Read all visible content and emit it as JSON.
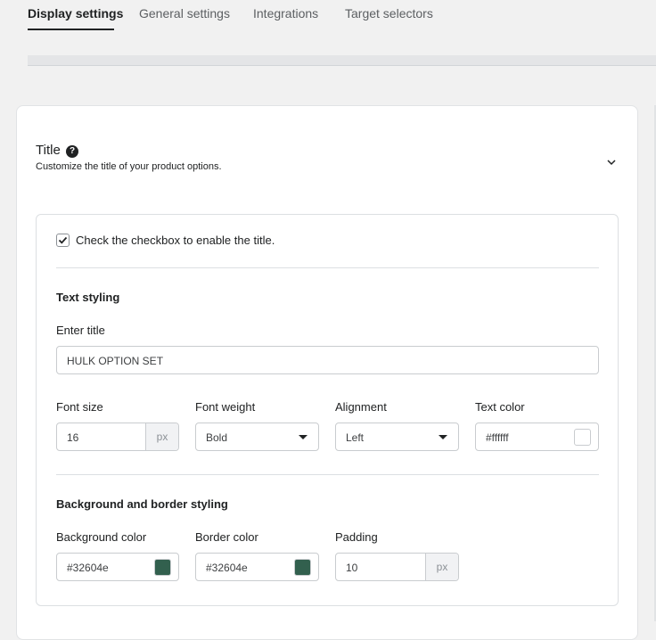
{
  "tabs": [
    {
      "label": "Display settings"
    },
    {
      "label": "General settings"
    },
    {
      "label": "Integrations"
    },
    {
      "label": "Target selectors"
    }
  ],
  "section": {
    "title": "Title",
    "description": "Customize the title of your product options.",
    "help_icon": "?"
  },
  "enable_checkbox": {
    "label": "Check the checkbox to enable the title.",
    "checked": true
  },
  "text_styling": {
    "heading": "Text styling",
    "enter_title_label": "Enter title",
    "title_value": "HULK OPTION SET",
    "font_size": {
      "label": "Font size",
      "value": "16",
      "unit": "px"
    },
    "font_weight": {
      "label": "Font weight",
      "value": "Bold"
    },
    "alignment": {
      "label": "Alignment",
      "value": "Left"
    },
    "text_color": {
      "label": "Text color",
      "value": "#ffffff",
      "swatch": "#ffffff"
    }
  },
  "bg_border": {
    "heading": "Background and border styling",
    "background_color": {
      "label": "Background color",
      "value": "#32604e",
      "swatch": "#32604e"
    },
    "border_color": {
      "label": "Border color",
      "value": "#32604e",
      "swatch": "#32604e"
    },
    "padding": {
      "label": "Padding",
      "value": "10",
      "unit": "px"
    }
  }
}
